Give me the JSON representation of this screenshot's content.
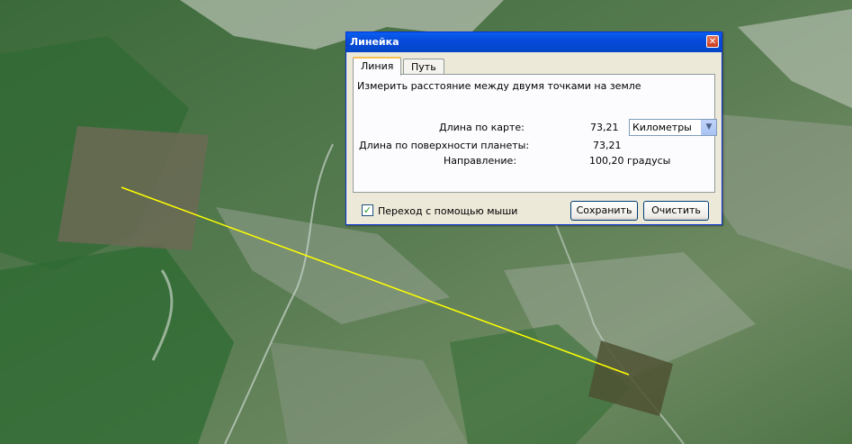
{
  "window": {
    "title": "Линейка",
    "close_glyph": "✕"
  },
  "tabs": [
    {
      "label": "Линия",
      "active": true
    },
    {
      "label": "Путь",
      "active": false
    }
  ],
  "panel": {
    "description": "Измерить расстояние между двумя точками на земле",
    "map_length_label": "Длина по карте:",
    "map_length_value": "73,21",
    "units_selected": "Километры",
    "surface_length_label": "Длина по поверхности планеты:",
    "surface_length_value": "73,21",
    "direction_label": "Направление:",
    "direction_value": "100,20 градусы"
  },
  "footer": {
    "mouse_nav_label": "Переход с помощью мыши",
    "mouse_nav_checked": true,
    "save_label": "Сохранить",
    "clear_label": "Очистить"
  },
  "colors": {
    "measure_line": "#FFFF00",
    "title_bar": "#0A5FF1"
  },
  "icons": {
    "close": "close-icon",
    "dropdown": "chevron-down-icon",
    "check": "checkmark-icon"
  }
}
